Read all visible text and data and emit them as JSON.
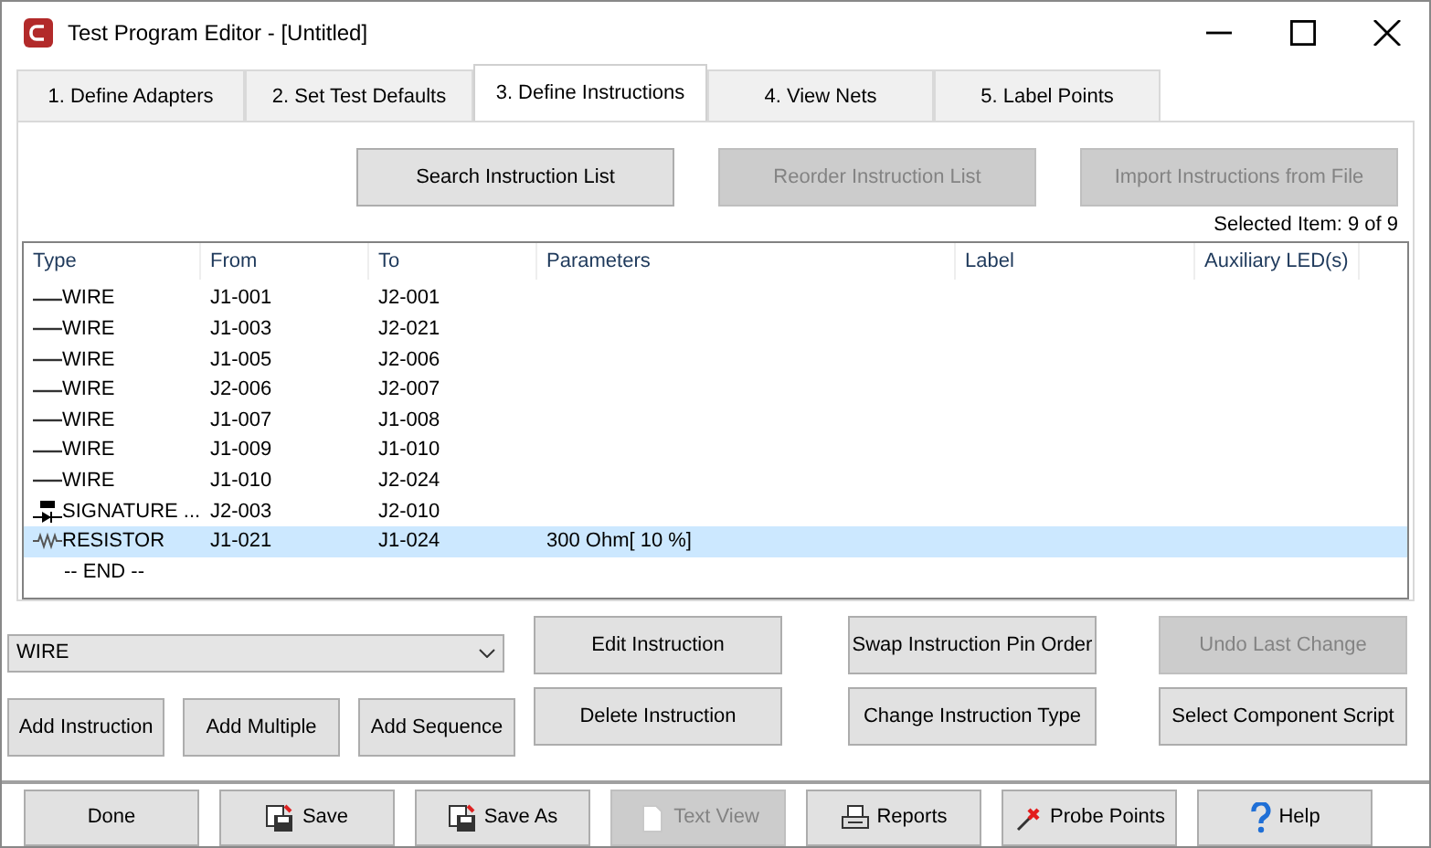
{
  "window": {
    "title": "Test Program Editor - [Untitled]"
  },
  "tabs": [
    {
      "label": "1. Define Adapters",
      "selected": false
    },
    {
      "label": "2.  Set Test Defaults",
      "selected": false
    },
    {
      "label": "3.  Define Instructions",
      "selected": true
    },
    {
      "label": "4.  View Nets",
      "selected": false
    },
    {
      "label": "5.  Label Points",
      "selected": false
    }
  ],
  "top_buttons": [
    {
      "label": "Search Instruction List",
      "disabled": false
    },
    {
      "label": "Reorder Instruction List",
      "disabled": true
    },
    {
      "label": "Import Instructions from File",
      "disabled": true
    }
  ],
  "selection_status": "Selected Item: 9 of 9",
  "table": {
    "columns": [
      "Type",
      "From",
      "To",
      "Parameters",
      "Label",
      "Auxiliary LED(s)"
    ],
    "rows": [
      {
        "kind": "wire",
        "type": "WIRE",
        "from": "J1-001",
        "to": "J2-001",
        "selected": false
      },
      {
        "kind": "wire",
        "type": "WIRE",
        "from": "J1-003",
        "to": "J2-021",
        "selected": false
      },
      {
        "kind": "wire",
        "type": "WIRE",
        "from": "J1-005",
        "to": "J2-006",
        "selected": false
      },
      {
        "kind": "wire",
        "type": "WIRE",
        "from": "J2-006",
        "to": "J2-007",
        "selected": false
      },
      {
        "kind": "wire",
        "type": "WIRE",
        "from": "J1-007",
        "to": "J1-008",
        "selected": false
      },
      {
        "kind": "wire",
        "type": "WIRE",
        "from": "J1-009",
        "to": "J1-010",
        "selected": false
      },
      {
        "kind": "wire",
        "type": "WIRE",
        "from": "J1-010",
        "to": "J2-024",
        "selected": false
      },
      {
        "kind": "signature",
        "type": "SIGNATURE ...",
        "from": "J2-003",
        "to": "J2-010",
        "selected": false
      },
      {
        "kind": "resistor",
        "type": "RESISTOR",
        "from": "J1-021",
        "to": "J1-024",
        "parameters": "300 Ohm[ 10 %]",
        "selected": true
      }
    ],
    "end_marker": "-- END --"
  },
  "instruction_type": {
    "value": "WIRE"
  },
  "left_buttons": [
    "Add Instruction",
    "Add Multiple",
    "Add Sequence"
  ],
  "middle_buttons": [
    {
      "label": "Edit Instruction",
      "disabled": false
    },
    {
      "label": "Delete Instruction",
      "disabled": false
    }
  ],
  "right_buttons": [
    {
      "label": "Swap Instruction Pin Order",
      "disabled": false
    },
    {
      "label": "Undo Last Change",
      "disabled": true
    },
    {
      "label": "Change Instruction Type",
      "disabled": false
    },
    {
      "label": "Select Component Script",
      "disabled": false
    }
  ],
  "footer_buttons": [
    {
      "label": "Done",
      "kind": "plain",
      "disabled": false
    },
    {
      "label": "Save",
      "kind": "save",
      "disabled": false
    },
    {
      "label": "Save As",
      "kind": "save",
      "disabled": false
    },
    {
      "label": "Text View",
      "kind": "page",
      "disabled": true
    },
    {
      "label": "Reports",
      "kind": "printer",
      "disabled": false
    },
    {
      "label": "Probe Points",
      "kind": "probe",
      "disabled": false
    },
    {
      "label": "Help",
      "kind": "help",
      "disabled": false
    }
  ]
}
